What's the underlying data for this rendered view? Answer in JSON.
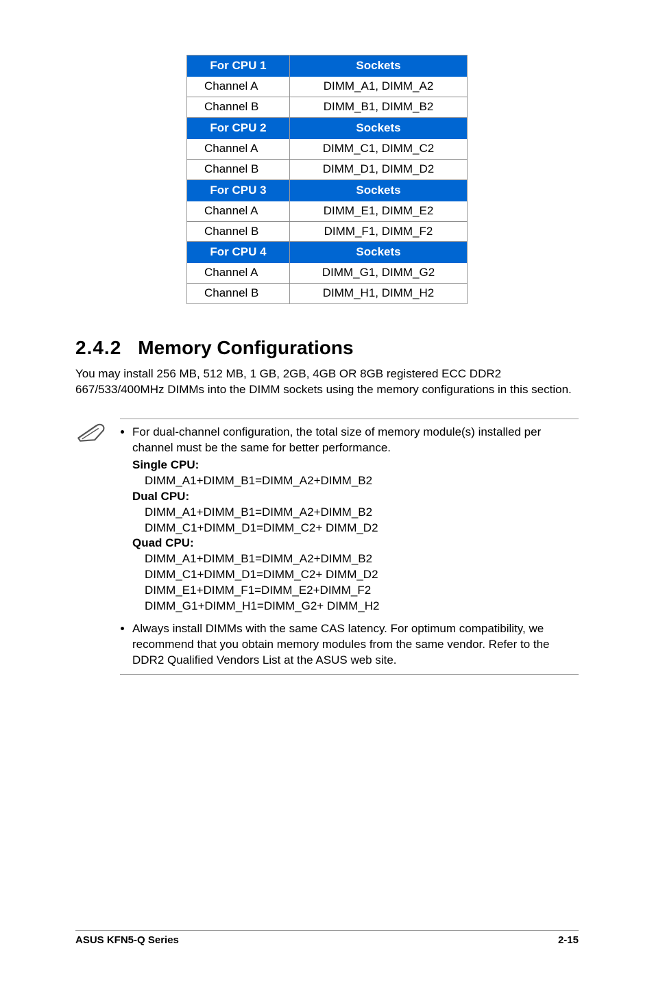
{
  "tables": [
    {
      "header": {
        "left": "For CPU 1",
        "right": "Sockets"
      },
      "rows": [
        {
          "ch": "Channel A",
          "sock": "DIMM_A1, DIMM_A2"
        },
        {
          "ch": "Channel B",
          "sock": "DIMM_B1, DIMM_B2"
        }
      ]
    },
    {
      "header": {
        "left": "For CPU 2",
        "right": "Sockets"
      },
      "rows": [
        {
          "ch": "Channel A",
          "sock": "DIMM_C1, DIMM_C2"
        },
        {
          "ch": "Channel B",
          "sock": "DIMM_D1, DIMM_D2"
        }
      ]
    },
    {
      "header": {
        "left": "For CPU 3",
        "right": "Sockets"
      },
      "rows": [
        {
          "ch": "Channel A",
          "sock": "DIMM_E1, DIMM_E2"
        },
        {
          "ch": "Channel B",
          "sock": "DIMM_F1, DIMM_F2"
        }
      ]
    },
    {
      "header": {
        "left": "For CPU 4",
        "right": "Sockets"
      },
      "rows": [
        {
          "ch": "Channel A",
          "sock": "DIMM_G1, DIMM_G2"
        },
        {
          "ch": "Channel B",
          "sock": "DIMM_H1, DIMM_H2"
        }
      ]
    }
  ],
  "heading": {
    "number": "2.4.2",
    "title": "Memory Configurations"
  },
  "intro": "You may install 256 MB, 512 MB, 1 GB, 2GB, 4GB OR 8GB registered ECC DDR2 667/533/400MHz DIMMs into the DIMM sockets using the memory configurations in this section.",
  "notes": {
    "bullet1_intro": "For dual-channel configuration, the total size of memory module(s) installed per channel must be the same for better performance.",
    "groups": [
      {
        "label": "Single CPU:",
        "lines": [
          "DIMM_A1+DIMM_B1=DIMM_A2+DIMM_B2"
        ]
      },
      {
        "label": "Dual CPU:",
        "lines": [
          "DIMM_A1+DIMM_B1=DIMM_A2+DIMM_B2",
          "DIMM_C1+DIMM_D1=DIMM_C2+ DIMM_D2"
        ]
      },
      {
        "label": "Quad CPU:",
        "lines": [
          "DIMM_A1+DIMM_B1=DIMM_A2+DIMM_B2",
          "DIMM_C1+DIMM_D1=DIMM_C2+ DIMM_D2",
          "DIMM_E1+DIMM_F1=DIMM_E2+DIMM_F2",
          "DIMM_G1+DIMM_H1=DIMM_G2+ DIMM_H2"
        ]
      }
    ],
    "bullet2": "Always install DIMMs with the same CAS latency. For optimum compatibility, we recommend that you obtain memory modules from the same vendor. Refer to the DDR2 Qualified Vendors List at the ASUS web site."
  },
  "footer": {
    "left": "ASUS KFN5-Q Series",
    "right": "2-15"
  }
}
